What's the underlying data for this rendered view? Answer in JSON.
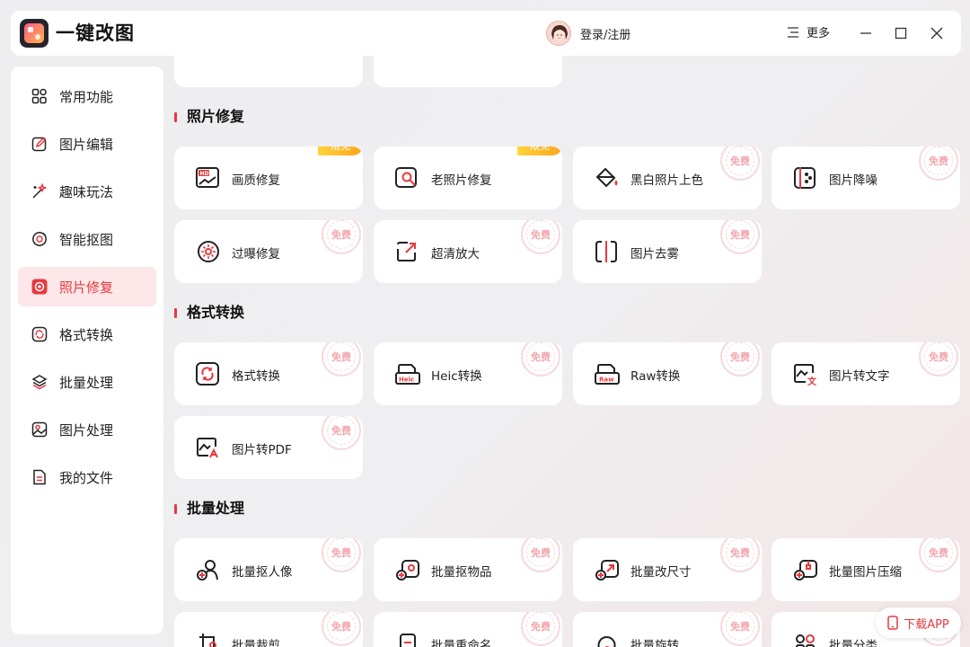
{
  "app": {
    "title": "一键改图"
  },
  "header": {
    "login_label": "登录/注册",
    "more_label": "更多"
  },
  "sidebar": {
    "items": [
      {
        "label": "常用功能",
        "icon": "grid-icon"
      },
      {
        "label": "图片编辑",
        "icon": "edit-icon"
      },
      {
        "label": "趣味玩法",
        "icon": "magic-icon"
      },
      {
        "label": "智能抠图",
        "icon": "cutout-icon"
      },
      {
        "label": "照片修复",
        "icon": "repair-icon",
        "active": true
      },
      {
        "label": "格式转换",
        "icon": "convert-icon"
      },
      {
        "label": "批量处理",
        "icon": "layers-icon"
      },
      {
        "label": "图片处理",
        "icon": "image-icon"
      },
      {
        "label": "我的文件",
        "icon": "file-icon"
      }
    ]
  },
  "sections": [
    {
      "title": "照片修复",
      "cards": [
        {
          "label": "画质修复",
          "badge": "限免",
          "icon": "hd-icon"
        },
        {
          "label": "老照片修复",
          "badge": "限免",
          "icon": "old-photo-icon"
        },
        {
          "label": "黑白照片上色",
          "badge": "免费",
          "icon": "paint-bucket-icon"
        },
        {
          "label": "图片降噪",
          "badge": "免费",
          "icon": "denoise-icon"
        },
        {
          "label": "过曝修复",
          "badge": "免费",
          "icon": "exposure-icon"
        },
        {
          "label": "超清放大",
          "badge": "免费",
          "icon": "upscale-icon"
        },
        {
          "label": "图片去雾",
          "badge": "免费",
          "icon": "dehaze-icon"
        }
      ]
    },
    {
      "title": "格式转换",
      "cards": [
        {
          "label": "格式转换",
          "badge": "免费",
          "icon": "format-icon"
        },
        {
          "label": "Heic转换",
          "badge": "免费",
          "icon": "heic-icon"
        },
        {
          "label": "Raw转换",
          "badge": "免费",
          "icon": "raw-icon"
        },
        {
          "label": "图片转文字",
          "badge": "免费",
          "icon": "ocr-icon"
        },
        {
          "label": "图片转PDF",
          "badge": "免费",
          "icon": "pdf-icon"
        }
      ]
    },
    {
      "title": "批量处理",
      "cards": [
        {
          "label": "批量抠人像",
          "badge": "免费",
          "icon": "batch-person-icon"
        },
        {
          "label": "批量抠物品",
          "badge": "免费",
          "icon": "batch-object-icon"
        },
        {
          "label": "批量改尺寸",
          "badge": "免费",
          "icon": "batch-resize-icon"
        },
        {
          "label": "批量图片压缩",
          "badge": "免费",
          "icon": "batch-compress-icon"
        },
        {
          "label": "批量裁剪",
          "badge": "免费",
          "icon": "batch-crop-icon"
        },
        {
          "label": "批量重命名",
          "badge": "免费",
          "icon": "batch-rename-icon"
        },
        {
          "label": "批量旋转",
          "badge": "免费",
          "icon": "batch-rotate-icon"
        },
        {
          "label": "批量分类",
          "badge": "免费",
          "icon": "batch-classify-icon"
        }
      ]
    }
  ],
  "download": {
    "label": "下载APP"
  },
  "colors": {
    "accent": "#e63a3f",
    "badge_gold": "#ffb01f",
    "stamp_pink": "#f3a7ad"
  }
}
